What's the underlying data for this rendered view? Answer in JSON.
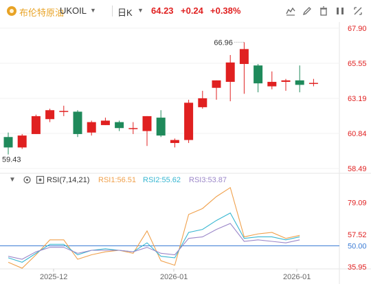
{
  "header": {
    "name": "布伦特原油",
    "code": "UKOIL",
    "period": "日K",
    "price": "64.23",
    "change": "+0.24",
    "change_pct": "+0.38%",
    "icons": [
      "chart-style-icon",
      "draw-icon",
      "delete-icon",
      "toggle-icon",
      "fullscreen-icon"
    ]
  },
  "colors": {
    "up": "#e02020",
    "down": "#1f8a5b",
    "rsi1": "#f0a04b",
    "rsi2": "#36b6d1",
    "rsi3": "#9b87c9",
    "baseline": "#3a7bd5"
  },
  "chart_data": [
    {
      "type": "candlestick",
      "price_axis": {
        "ticks": [
          "67.90",
          "65.55",
          "63.19",
          "60.84",
          "58.49"
        ],
        "ylim": [
          58.49,
          67.9
        ]
      },
      "annotations": {
        "high_label": "66.96",
        "low_label": "59.43"
      },
      "candles": [
        {
          "o": 60.6,
          "h": 60.9,
          "l": 59.43,
          "c": 59.9
        },
        {
          "o": 59.9,
          "h": 60.8,
          "l": 59.8,
          "c": 60.7
        },
        {
          "o": 60.8,
          "h": 62.1,
          "l": 60.8,
          "c": 62.0
        },
        {
          "o": 61.8,
          "h": 62.5,
          "l": 61.6,
          "c": 62.4
        },
        {
          "o": 62.3,
          "h": 62.7,
          "l": 62.0,
          "c": 62.35
        },
        {
          "o": 62.3,
          "h": 62.4,
          "l": 60.6,
          "c": 60.8
        },
        {
          "o": 60.9,
          "h": 61.7,
          "l": 60.7,
          "c": 61.6
        },
        {
          "o": 61.4,
          "h": 61.9,
          "l": 61.4,
          "c": 61.7
        },
        {
          "o": 61.6,
          "h": 61.7,
          "l": 61.0,
          "c": 61.2
        },
        {
          "o": 61.2,
          "h": 61.6,
          "l": 60.8,
          "c": 61.2
        },
        {
          "o": 61.0,
          "h": 62.0,
          "l": 60.0,
          "c": 62.0
        },
        {
          "o": 61.9,
          "h": 62.4,
          "l": 60.6,
          "c": 60.7
        },
        {
          "o": 60.2,
          "h": 60.5,
          "l": 59.9,
          "c": 60.4
        },
        {
          "o": 60.4,
          "h": 63.1,
          "l": 60.2,
          "c": 62.9
        },
        {
          "o": 62.6,
          "h": 63.7,
          "l": 62.5,
          "c": 63.2
        },
        {
          "o": 63.9,
          "h": 64.4,
          "l": 63.1,
          "c": 64.4
        },
        {
          "o": 64.3,
          "h": 66.1,
          "l": 63.0,
          "c": 65.6
        },
        {
          "o": 65.5,
          "h": 66.96,
          "l": 63.5,
          "c": 66.5
        },
        {
          "o": 65.4,
          "h": 65.5,
          "l": 63.6,
          "c": 64.2
        },
        {
          "o": 64.0,
          "h": 65.0,
          "l": 63.8,
          "c": 64.3
        },
        {
          "o": 64.3,
          "h": 64.5,
          "l": 63.7,
          "c": 64.4
        },
        {
          "o": 64.4,
          "h": 65.4,
          "l": 63.6,
          "c": 64.1
        },
        {
          "o": 64.2,
          "h": 64.5,
          "l": 64.0,
          "c": 64.23
        }
      ]
    },
    {
      "type": "line",
      "title": "RSI(7,14,21)",
      "series": [
        {
          "name": "RSI1",
          "label": "RSI1:56.51",
          "values": [
            39,
            35,
            44,
            54,
            54,
            41,
            44,
            46,
            47,
            45,
            60,
            40,
            37,
            71,
            75,
            83,
            89,
            56,
            58,
            59,
            55,
            57
          ]
        },
        {
          "name": "RSI2",
          "label": "RSI2:55.62",
          "values": [
            42,
            39,
            45,
            51,
            51,
            44,
            47,
            48,
            47,
            46,
            52,
            43,
            42,
            59,
            61,
            67,
            72,
            55,
            56,
            56,
            54,
            56
          ]
        },
        {
          "name": "RSI3",
          "label": "RSI3:53.87",
          "values": [
            43,
            41,
            46,
            49,
            49,
            45,
            47,
            47,
            47,
            46,
            49,
            45,
            44,
            55,
            56,
            61,
            65,
            53,
            54,
            53,
            52,
            54
          ]
        }
      ],
      "y_axis": {
        "ticks": [
          "79.09",
          "57.52",
          "50.00",
          "35.95"
        ],
        "ylim": [
          35.95,
          88.0
        ]
      },
      "reference_line": 50
    }
  ],
  "x_axis": {
    "labels": [
      "2025-12",
      "2026-01",
      "2026-01"
    ]
  }
}
